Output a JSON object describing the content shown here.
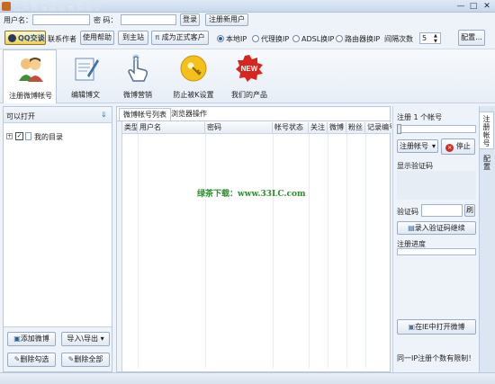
{
  "window": {
    "title": "石头微博超级营销助手",
    "min": "—",
    "max": "□",
    "close": "✕"
  },
  "login": {
    "username_label": "用户名：",
    "username_value": "",
    "password_label": "密  码：",
    "password_value": "",
    "login_button": "登录",
    "register_button": "注册新用户"
  },
  "toolbar": {
    "qq_button": "QQ交谈",
    "contact_author": "联系作者",
    "help": "使用帮助",
    "home": "到主站",
    "upgrade": "成为正式客户",
    "ip_options": [
      "本地IP",
      "代理换IP",
      "ADSL换IP",
      "路由器换IP"
    ],
    "ip_selected": "本地IP",
    "interval_label": "间隔次数",
    "interval_value": "5",
    "config_button": "配置..."
  },
  "nav": [
    {
      "label": "注册微博帐号",
      "icon": "people-icon",
      "active": true
    },
    {
      "label": "编辑博文",
      "icon": "edit-document-icon",
      "active": false
    },
    {
      "label": "微博营销",
      "icon": "hand-pointer-icon",
      "active": false
    },
    {
      "label": "防止被K设置",
      "icon": "key-icon",
      "active": false
    },
    {
      "label": "我们的产品",
      "icon": "new-badge-icon",
      "active": false
    }
  ],
  "left_panel": {
    "header": "可以打开",
    "tree_item": "我的目录",
    "add_button": "添加微博",
    "import_export_button": "导入\\导出",
    "delete_checked_button": "删除勾选",
    "delete_all_button": "删除全部"
  },
  "center": {
    "tabs": [
      "微博帐号列表",
      "浏览器操作"
    ],
    "columns": [
      "类型",
      "用户名",
      "密码",
      "帐号状态",
      "关注",
      "微博",
      "粉丝",
      "记录编号"
    ],
    "watermark": "绿茶下载：www.33LC.com"
  },
  "right_panel": {
    "register_count_label": "注册 1 个帐号",
    "register_dropdown": "注册帐号",
    "stop_button": "停止",
    "show_captcha_label": "显示验证码",
    "captcha_label": "验证码",
    "captcha_value": "",
    "refresh_button": "刷",
    "enter_captcha_button": "录入验证码继续",
    "progress_label": "注册进度",
    "progress": 0,
    "open_ie_button": "在IE中打开微博",
    "limit_link": "同一IP注册个数有限制！"
  },
  "side_tabs": [
    "注册帐号",
    "配置"
  ]
}
